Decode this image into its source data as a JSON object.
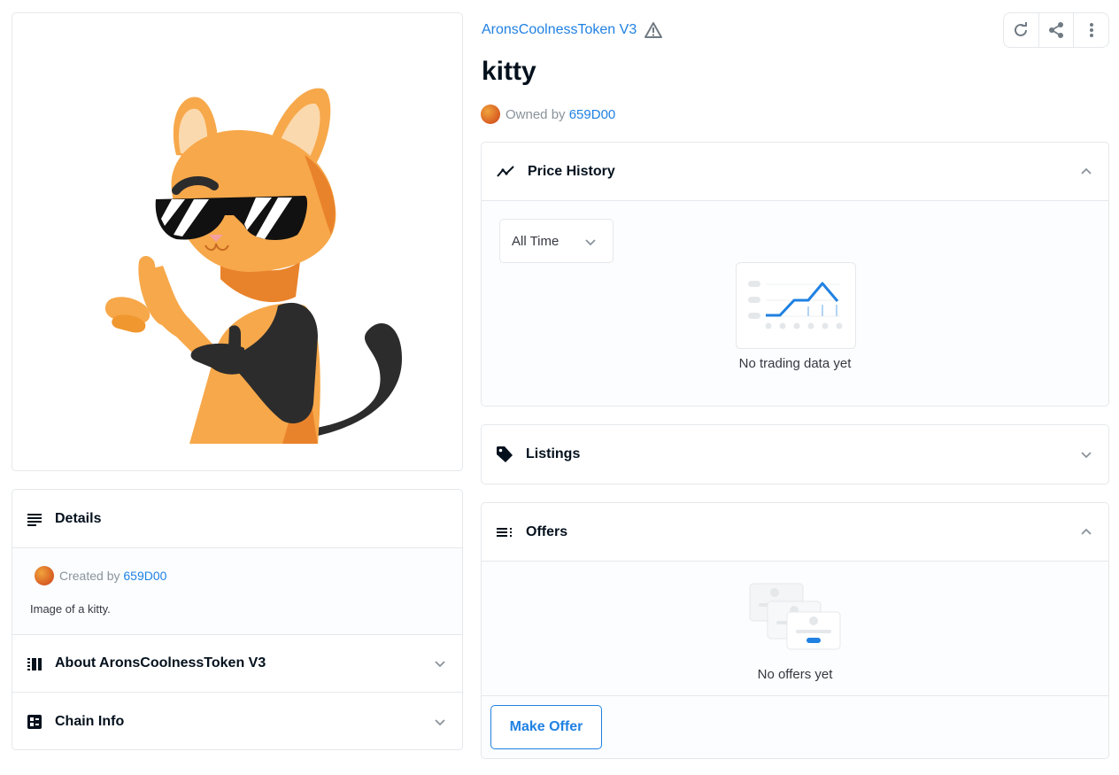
{
  "item": {
    "collection_name": "AronsCoolnessToken V3",
    "title": "kitty",
    "owned_by_label": "Owned by",
    "owner": "659D00"
  },
  "toolbar": {
    "refresh_icon": "refresh-icon",
    "share_icon": "share-icon",
    "more_icon": "more-vertical-icon"
  },
  "details": {
    "header": "Details",
    "created_by_label": "Created by",
    "creator": "659D00",
    "description": "Image of a kitty.",
    "about_header": "About AronsCoolnessToken V3",
    "chain_info_header": "Chain Info"
  },
  "price_history": {
    "header": "Price History",
    "range_selected": "All Time",
    "empty_text": "No trading data yet"
  },
  "listings": {
    "header": "Listings"
  },
  "offers": {
    "header": "Offers",
    "empty_text": "No offers yet",
    "make_offer_label": "Make Offer"
  },
  "colors": {
    "link": "#2081e2",
    "border": "#e5e8eb",
    "panel_bg": "#fbfdff",
    "cat_orange": "#f7a84a",
    "cat_dark": "#2c2c2c"
  }
}
